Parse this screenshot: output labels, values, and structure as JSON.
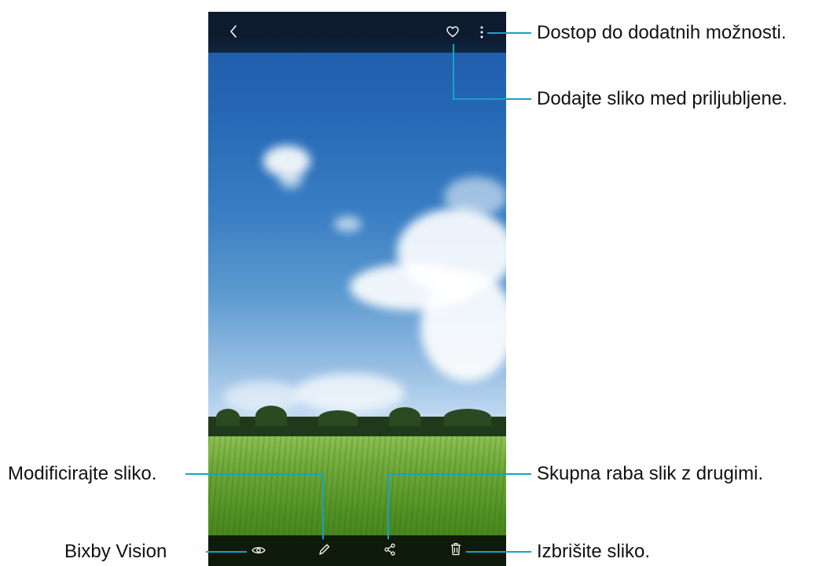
{
  "app": {
    "topbar": {
      "icons": [
        "back-icon",
        "heart-icon",
        "more-options-icon"
      ]
    },
    "bottombar": {
      "icons": [
        "eye-icon",
        "pencil-icon",
        "share-icon",
        "trash-icon"
      ]
    }
  },
  "callouts": {
    "more_options": "Dostop do dodatnih možnosti.",
    "favorites": "Dodajte sliko med priljubljene.",
    "edit": "Modificirajte sliko.",
    "share": "Skupna raba slik z drugimi.",
    "bixby": "Bixby Vision",
    "delete": "Izbrišite sliko."
  },
  "colors": {
    "callout_line": "#1aa0c8",
    "toolbar": "#0d1b2e",
    "icon": "#ffffff"
  }
}
